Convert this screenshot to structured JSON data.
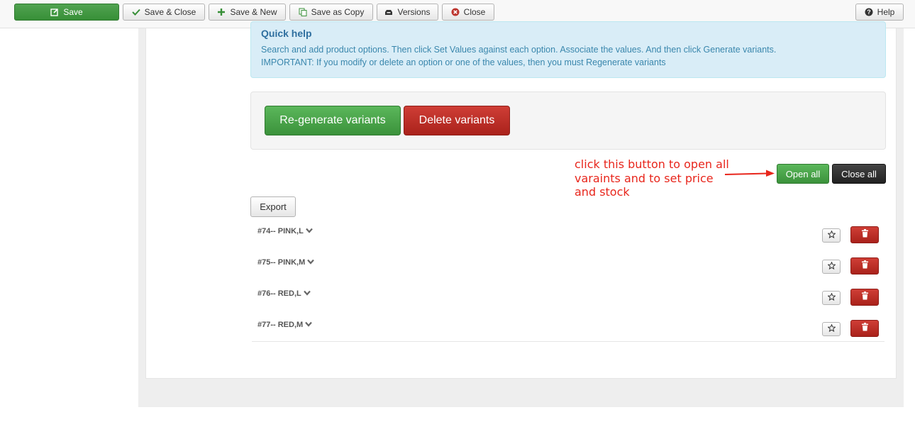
{
  "toolbar": {
    "save": "Save",
    "save_close": "Save & Close",
    "save_new": "Save & New",
    "save_copy": "Save as Copy",
    "versions": "Versions",
    "close": "Close",
    "help": "Help"
  },
  "quick_help": {
    "title": "Quick help",
    "line1": "Search and add product options. Then click Set Values against each option. Associate the values. And then click Generate variants.",
    "line2": "IMPORTANT: If you modify or delete an option or one of the values, then you must Regenerate variants"
  },
  "actions": {
    "regenerate": "Re-generate variants",
    "delete": "Delete variants",
    "open_all": "Open all",
    "close_all": "Close all",
    "export": "Export"
  },
  "annotation": {
    "line1": "click this button to open all",
    "line2": "varaints and to set price",
    "line3": "and stock",
    "color": "#e8261c"
  },
  "variants": [
    {
      "label": "#74-- PINK,L"
    },
    {
      "label": "#75-- PINK,M"
    },
    {
      "label": "#76-- RED,L"
    },
    {
      "label": "#77-- RED,M"
    }
  ],
  "colors": {
    "success": "#51a351",
    "danger": "#bd362f",
    "info_bg": "#d9edf7",
    "info_text": "#3a87ad",
    "inverse": "#333333"
  },
  "icons": {
    "save": "edit-icon",
    "save_close": "check-icon",
    "save_new": "plus-icon",
    "save_copy": "copy-icon",
    "versions": "archive-icon",
    "close": "cancel-icon",
    "help": "question-icon",
    "variant_toggle": "chevron-down-icon",
    "default": "star-icon",
    "delete": "trash-icon"
  }
}
